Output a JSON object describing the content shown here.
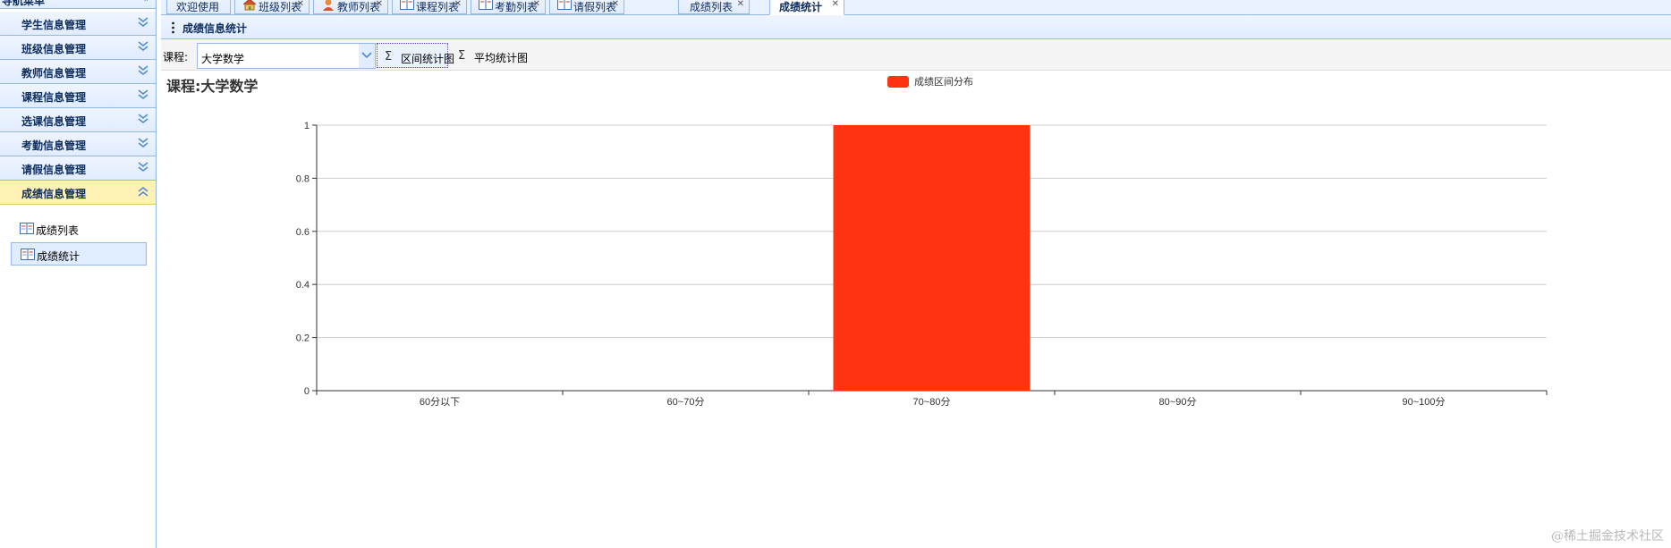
{
  "sidebar": {
    "title": "导航菜单",
    "items": [
      {
        "label": "学生信息管理"
      },
      {
        "label": "班级信息管理"
      },
      {
        "label": "教师信息管理"
      },
      {
        "label": "课程信息管理"
      },
      {
        "label": "选课信息管理"
      },
      {
        "label": "考勤信息管理"
      },
      {
        "label": "请假信息管理"
      },
      {
        "label": "成绩信息管理",
        "active": true
      }
    ],
    "sub_items": [
      {
        "label": "成绩列表"
      },
      {
        "label": "成绩统计",
        "selected": true
      }
    ]
  },
  "tabs": [
    {
      "label": "欢迎使用",
      "icon": ""
    },
    {
      "label": "班级列表",
      "icon": "house-icon"
    },
    {
      "label": "教师列表",
      "icon": "teacher-icon"
    },
    {
      "label": "课程列表",
      "icon": "book-icon"
    },
    {
      "label": "考勤列表",
      "icon": "book-icon"
    },
    {
      "label": "请假列表",
      "icon": "book-icon"
    },
    {
      "label": "成绩列表",
      "icon": ""
    },
    {
      "label": "成绩统计",
      "icon": "",
      "active": true
    }
  ],
  "panel": {
    "title": "成绩信息统计"
  },
  "toolbar": {
    "course_label": "课程:",
    "course_value": "大学数学",
    "range_button": "区间统计图",
    "average_button": "平均统计图"
  },
  "chart_title": "课程:大学数学",
  "chart_data": {
    "type": "bar",
    "title": "",
    "xlabel": "",
    "ylabel": "",
    "categories": [
      "60分以下",
      "60~70分",
      "70~80分",
      "80~90分",
      "90~100分"
    ],
    "series": [
      {
        "name": "成绩区间分布",
        "values": [
          0,
          0,
          1,
          0,
          0
        ],
        "color": "#ff3311"
      }
    ],
    "ylim": [
      0,
      1
    ],
    "yticks": [
      "0",
      "0.2",
      "0.4",
      "0.6",
      "0.8",
      "1"
    ],
    "grid": true,
    "legend": "top-center"
  },
  "watermark": "@稀土掘金技术社区",
  "colors": {
    "accent": "#95b8e7",
    "bar": "#ff3311",
    "active_nav": "#fff2b4"
  }
}
